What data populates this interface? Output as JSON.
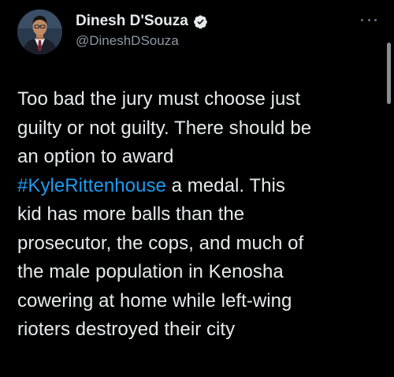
{
  "tweet": {
    "author": {
      "display_name": "Dinesh D'Souza",
      "handle": "@DineshDSouza",
      "verified": true,
      "avatar_icon": "profile-photo"
    },
    "more_icon": "more-options-icon",
    "body_lines": [
      {
        "text": "Too bad the jury must choose just"
      },
      {
        "text": "guilty or not guilty. There should be"
      },
      {
        "text": "an option to award"
      },
      {
        "hashtag": "#KyleRittenhouse",
        "text": " a medal. This"
      },
      {
        "text": "kid has more balls than the"
      },
      {
        "text": "prosecutor, the cops, and much of"
      },
      {
        "text": "the male population in Kenosha"
      },
      {
        "text": "cowering at home while left-wing"
      },
      {
        "text": "rioters destroyed their city"
      }
    ]
  },
  "colors": {
    "background": "#000000",
    "text": "#e7e9ea",
    "secondary_text": "#8b98a5",
    "link": "#1d9bf0",
    "verified_badge": "#1d9bf0"
  }
}
